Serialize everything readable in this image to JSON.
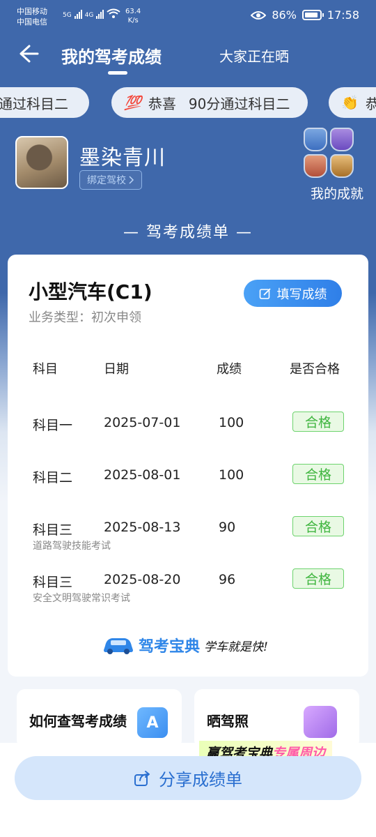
{
  "status_bar": {
    "carrier1": "中国移动",
    "carrier2": "中国电信",
    "net1": "5G",
    "net2": "4G",
    "speed_value": "63.4",
    "speed_unit": "K/s",
    "battery": "86%",
    "time": "17:58"
  },
  "header": {
    "tab_active": "我的驾考成绩",
    "tab_other": "大家正在晒"
  },
  "ticker": [
    {
      "text": "分通过科目二"
    },
    {
      "emoji": "💯",
      "prefix": "恭喜",
      "text": "90分通过科目二"
    },
    {
      "emoji": "👏",
      "prefix": "恭"
    }
  ],
  "profile": {
    "name": "墨染青川",
    "bind_label": "绑定驾校",
    "achievements_label": "我的成就"
  },
  "section_title": "— 驾考成绩单 —",
  "card": {
    "license": "小型汽车(C1)",
    "business_type": "业务类型：初次申领",
    "fill_button": "填写成绩",
    "headers": {
      "subject": "科目",
      "date": "日期",
      "score": "成绩",
      "pass": "是否合格"
    },
    "rows": [
      {
        "subject": "科目一",
        "date": "2025-07-01",
        "score": "100",
        "pass": "合格",
        "note": ""
      },
      {
        "subject": "科目二",
        "date": "2025-08-01",
        "score": "100",
        "pass": "合格",
        "note": ""
      },
      {
        "subject": "科目三",
        "date": "2025-08-13",
        "score": "90",
        "pass": "合格",
        "note": "道路驾驶技能考试"
      },
      {
        "subject": "科目三",
        "date": "2025-08-20",
        "score": "96",
        "pass": "合格",
        "note": "安全文明驾驶常识考试"
      }
    ],
    "brand_name": "驾考宝典",
    "brand_slogan": "学车就是快!"
  },
  "tiles": {
    "query": "如何查驾考成绩",
    "query_icon_letter": "A",
    "license_photo": "晒驾照"
  },
  "promo": {
    "part1": "赢驾考宝典",
    "part2": "专属周边"
  },
  "share_button": "分享成绩单",
  "icons": [
    "back-arrow-icon",
    "eye-icon",
    "wifi-icon",
    "battery-icon",
    "chevron-right-icon",
    "edit-icon",
    "share-icon",
    "car-icon",
    "badge-icon"
  ],
  "colors": {
    "header_blue": "#3f68ab",
    "accent_blue": "#2f7fe8",
    "pass_green": "#3fb53f",
    "hundred_red": "#e23b3b"
  }
}
